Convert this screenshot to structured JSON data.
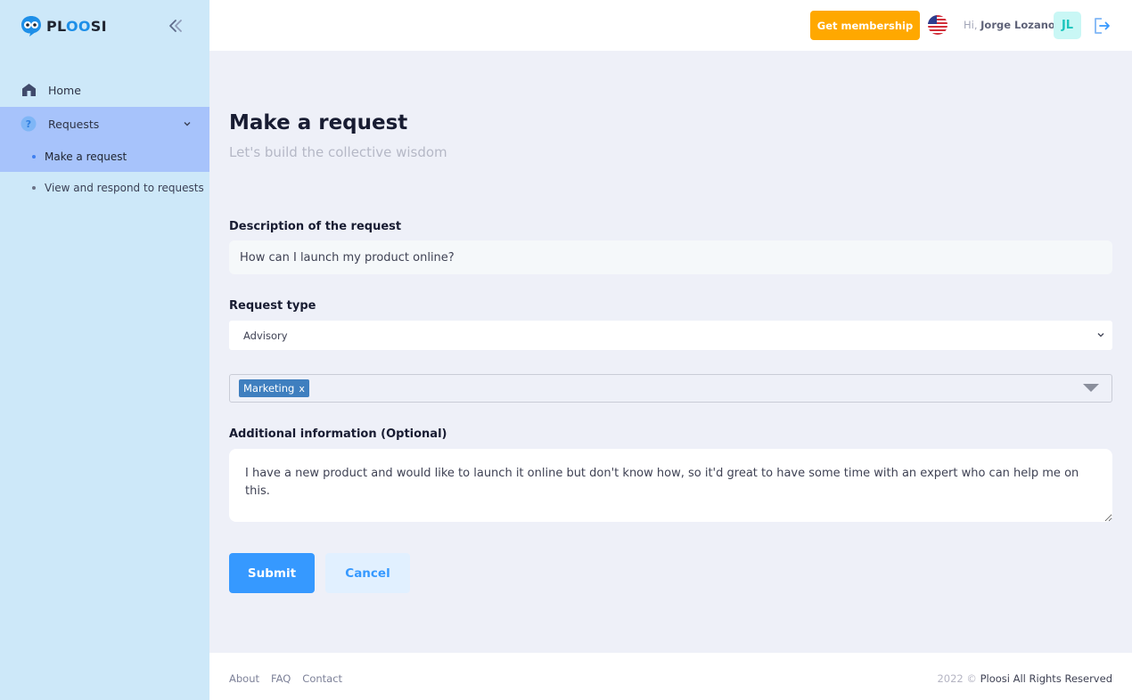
{
  "brand": {
    "name_prefix": "PL",
    "name_highlight": "OO",
    "name_suffix": "SI"
  },
  "sidebar": {
    "items": [
      {
        "label": "Home",
        "icon": "home-icon"
      },
      {
        "label": "Requests",
        "icon": "question-icon",
        "expanded": true
      }
    ],
    "subitems": [
      {
        "label": "Make a request",
        "active": true
      },
      {
        "label": "View and respond to requests",
        "active": false
      }
    ]
  },
  "header": {
    "membership_label": "Get membership",
    "greeting_prefix": "Hi,",
    "user_name": "Jorge Lozano",
    "avatar_initials": "JL",
    "language_flag": "us-flag-icon"
  },
  "page": {
    "title": "Make a request",
    "subtitle": "Let's build the collective wisdom"
  },
  "form": {
    "description_label": "Description of the request",
    "description_value": "How can I launch my product online?",
    "type_label": "Request type",
    "type_value": "Advisory",
    "tags": [
      {
        "label": "Marketing",
        "remove": "x"
      }
    ],
    "additional_label": "Additional information (Optional)",
    "additional_value": "I have a new product and would like to launch it online but don't know how, so it'd great to have some time with an expert who can help me on this.",
    "submit_label": "Submit",
    "cancel_label": "Cancel"
  },
  "footer": {
    "links": [
      "About",
      "FAQ",
      "Contact"
    ],
    "year": "2022 ©",
    "rights": "Ploosi All Rights Reserved"
  },
  "colors": {
    "sidebar_bg": "#cde8f9",
    "active_bg": "#a7c3fb",
    "primary": "#3699ff",
    "membership": "#ffa800"
  }
}
